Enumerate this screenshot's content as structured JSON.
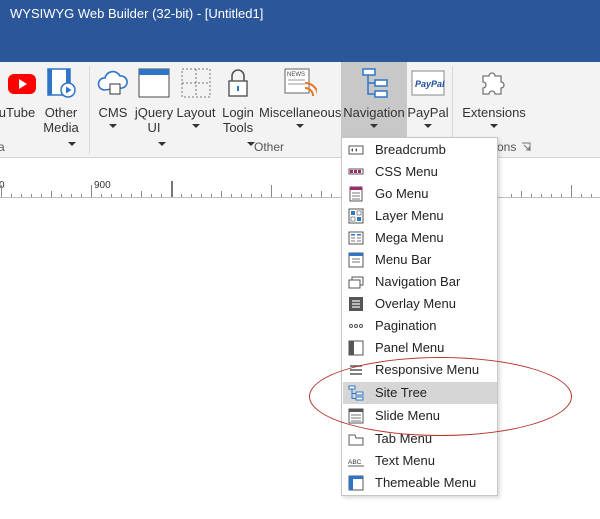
{
  "window": {
    "title": "WYSIWYG Web Builder (32-bit) - [Untitled1]"
  },
  "ribbon": {
    "buttons": [
      {
        "label": "uTube"
      },
      {
        "label": "Other",
        "label2": "Media"
      },
      {
        "label": "CMS"
      },
      {
        "label": "jQuery",
        "label2": "UI"
      },
      {
        "label": "Layout"
      },
      {
        "label": "Login",
        "label2": "Tools"
      },
      {
        "label": "Miscellaneous"
      },
      {
        "label": "Navigation"
      },
      {
        "label": "PayPal"
      },
      {
        "label": "Extensions"
      }
    ],
    "groups": [
      {
        "label": "a"
      },
      {
        "label": "Other"
      },
      {
        "label": "ons"
      }
    ],
    "paypal_text": "PayPal",
    "news_text": "NEWS"
  },
  "ruler": {
    "labels": [
      "0",
      "900"
    ]
  },
  "navigation_menu": {
    "items": [
      {
        "label": "Breadcrumb",
        "icon": "breadcrumb-icon"
      },
      {
        "label": "CSS Menu",
        "icon": "css-menu-icon"
      },
      {
        "label": "Go Menu",
        "icon": "go-menu-icon"
      },
      {
        "label": "Layer Menu",
        "icon": "layer-menu-icon"
      },
      {
        "label": "Mega Menu",
        "icon": "mega-menu-icon"
      },
      {
        "label": "Menu Bar",
        "icon": "menu-bar-icon"
      },
      {
        "label": "Navigation Bar",
        "icon": "navigation-bar-icon"
      },
      {
        "label": "Overlay Menu",
        "icon": "overlay-menu-icon"
      },
      {
        "label": "Pagination",
        "icon": "pagination-icon"
      },
      {
        "label": "Panel Menu",
        "icon": "panel-menu-icon"
      },
      {
        "label": "Responsive Menu",
        "icon": "responsive-menu-icon"
      },
      {
        "label": "Site Tree",
        "icon": "site-tree-icon",
        "highlighted": true
      },
      {
        "label": "Slide Menu",
        "icon": "slide-menu-icon"
      },
      {
        "label": "Tab Menu",
        "icon": "tab-menu-icon"
      },
      {
        "label": "Text Menu",
        "icon": "text-menu-icon"
      },
      {
        "label": "Themeable Menu",
        "icon": "themeable-menu-icon"
      }
    ],
    "text_menu_icon_text": "ABC"
  },
  "colors": {
    "titlebar": "#2b579a",
    "annotation": "#b5342a",
    "accent_blue": "#2e75c7"
  }
}
